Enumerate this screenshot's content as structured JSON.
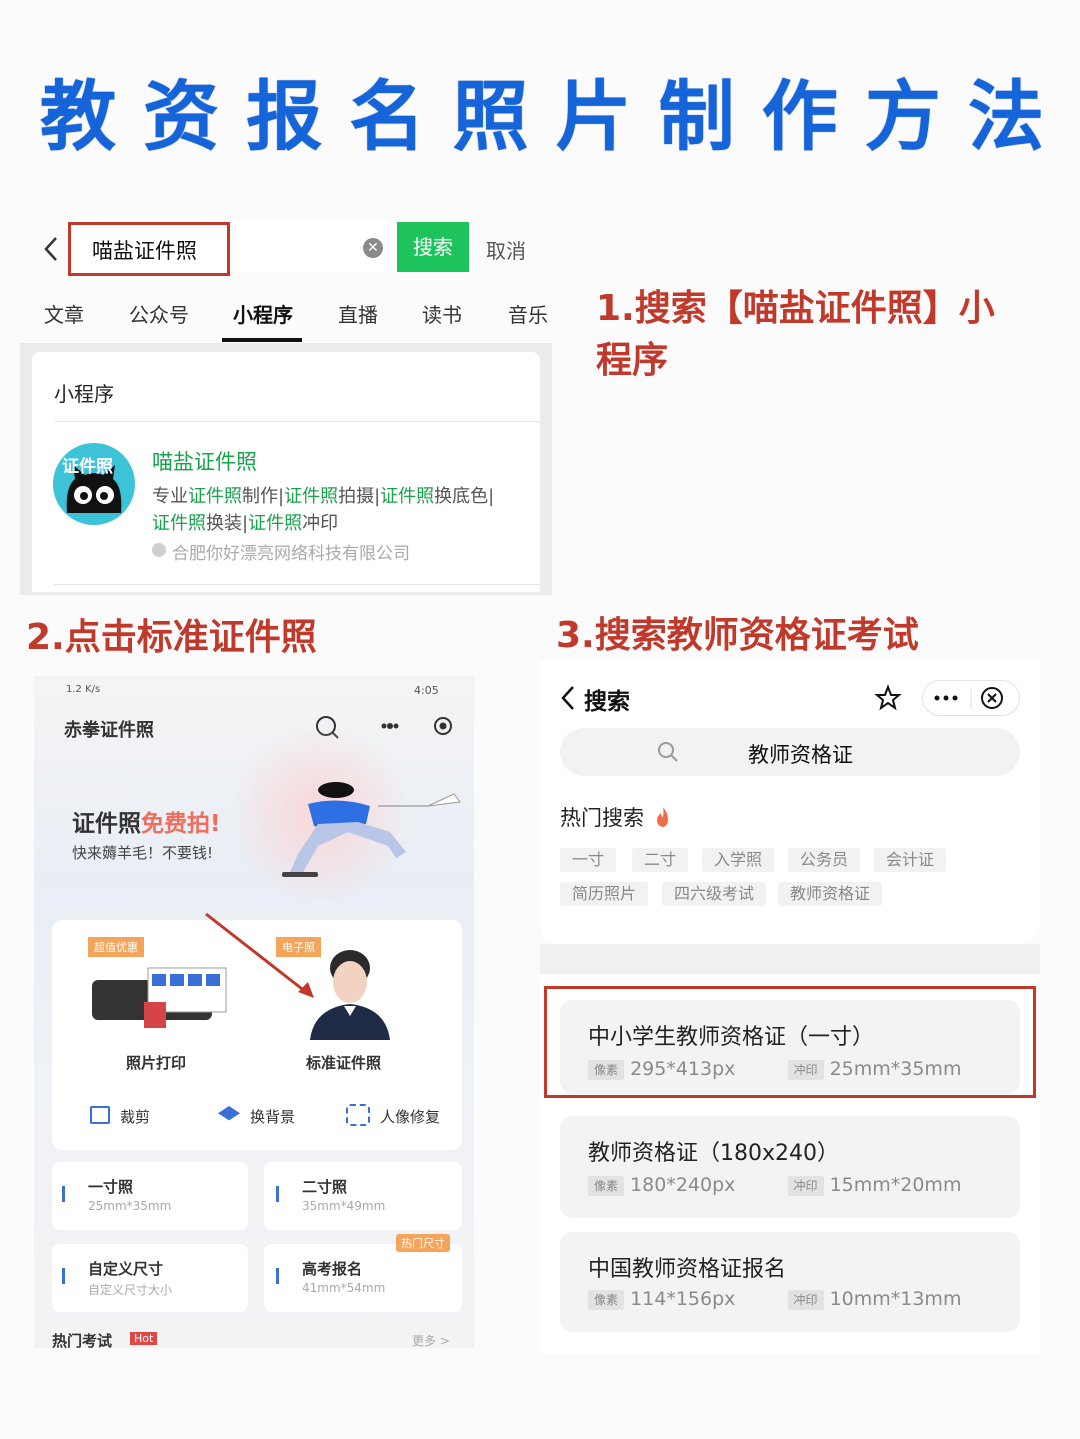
{
  "title": "教资报名照片制作方法",
  "title_chars": [
    "教",
    "资",
    "报",
    "名",
    "照",
    "片",
    "制",
    "作",
    "方",
    "法"
  ],
  "steps": {
    "s1_line1": "1.搜索【喵盐证件照】小",
    "s1_line2": "程序",
    "s2": "2.点击标准证件照",
    "s3": "3.搜索教师资格证考试"
  },
  "panel1": {
    "search_value": "喵盐证件照",
    "search_button": "搜索",
    "cancel": "取消",
    "tabs": [
      "文章",
      "公众号",
      "小程序",
      "直播",
      "读书",
      "音乐"
    ],
    "active_tab": "小程序",
    "section_title": "小程序",
    "app_name": "喵盐证件照",
    "avatar_text": "证件照",
    "desc_parts": [
      "专业",
      "证件照",
      "制作|",
      "证件照",
      "拍摄|",
      "证件照",
      "换底色|"
    ],
    "desc_parts2": [
      "证件照",
      "换装|",
      "证件照",
      "冲印"
    ],
    "company": "合肥你好漂亮网络科技有限公司"
  },
  "panel2": {
    "status_left": "1.2 K/s",
    "status_right": "4:05",
    "app_title": "赤拳证件照",
    "banner_title_a": "证件照",
    "banner_title_b": "免费拍!",
    "banner_sub": "快来薅羊毛！不要钱!",
    "badge_left": "超值优惠",
    "badge_right": "电子照",
    "print_label": "照片打印",
    "standard_label": "标准证件照",
    "tools": [
      "裁剪",
      "换背景",
      "人像修复"
    ],
    "sizes": [
      {
        "name": "一寸照",
        "dim": "25mm*35mm"
      },
      {
        "name": "二寸照",
        "dim": "35mm*49mm"
      },
      {
        "name": "自定义尺寸",
        "dim": "自定义尺寸大小"
      },
      {
        "name": "高考报名",
        "dim": "41mm*54mm"
      }
    ],
    "hot_size_badge": "热门尺寸",
    "hot_exam": "热门考试",
    "hot_badge": "Hot",
    "more": "更多 >"
  },
  "panel3": {
    "back_title": "搜索",
    "query": "教师资格证",
    "hot_title": "热门搜索",
    "hot_tags_row1": [
      "一寸",
      "二寸",
      "入学照",
      "公务员",
      "会计证"
    ],
    "hot_tags_row2": [
      "简历照片",
      "四六级考试",
      "教师资格证"
    ],
    "results": [
      {
        "title": "中小学生教师资格证（一寸）",
        "px_tag": "像素",
        "px": "295*413px",
        "print_tag": "冲印",
        "mm": "25mm*35mm"
      },
      {
        "title": "教师资格证（180x240）",
        "px_tag": "像素",
        "px": "180*240px",
        "print_tag": "冲印",
        "mm": "15mm*20mm"
      },
      {
        "title": "中国教师资格证报名",
        "px_tag": "像素",
        "px": "114*156px",
        "print_tag": "冲印",
        "mm": "10mm*13mm"
      }
    ]
  },
  "colors": {
    "title_blue": "#1664d9",
    "step_red": "#c0392b",
    "green": "#1dc35b",
    "highlight_red": "#c0392b"
  }
}
